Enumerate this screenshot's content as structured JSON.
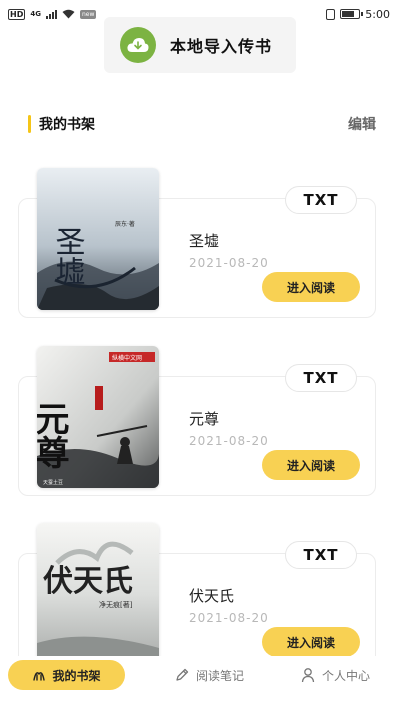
{
  "status_bar": {
    "hd": "HD",
    "network": "4G",
    "badge": "new",
    "time": "5:00",
    "battery_level": 0.8
  },
  "import": {
    "label": "本地导入传书",
    "icon": "cloud-download-icon",
    "icon_color": "#7cb342"
  },
  "shelf": {
    "title": "我的书架",
    "edit_label": "编辑",
    "accent_color": "#f5c518"
  },
  "books": [
    {
      "format": "TXT",
      "title": "圣墟",
      "date": "2021-08-20",
      "read_label": "进入阅读",
      "cover": "cover-shengxu"
    },
    {
      "format": "TXT",
      "title": "元尊",
      "date": "2021-08-20",
      "read_label": "进入阅读",
      "cover": "cover-yuanzun"
    },
    {
      "format": "TXT",
      "title": "伏天氏",
      "date": "2021-08-20",
      "read_label": "进入阅读",
      "cover": "cover-futianshi"
    }
  ],
  "covers": {
    "shengxu": {
      "title_art": "圣墟",
      "author": "辰东·著"
    },
    "yuanzun": {
      "title_art": "元尊",
      "publisher": "纵横中文网",
      "author": "天蚕土豆"
    },
    "futianshi": {
      "title_art": "伏天氏",
      "author": "净无痕[著]"
    }
  },
  "nav": {
    "shelf": "我的书架",
    "notes": "阅读笔记",
    "profile": "个人中心",
    "active_color": "#f8d153"
  }
}
